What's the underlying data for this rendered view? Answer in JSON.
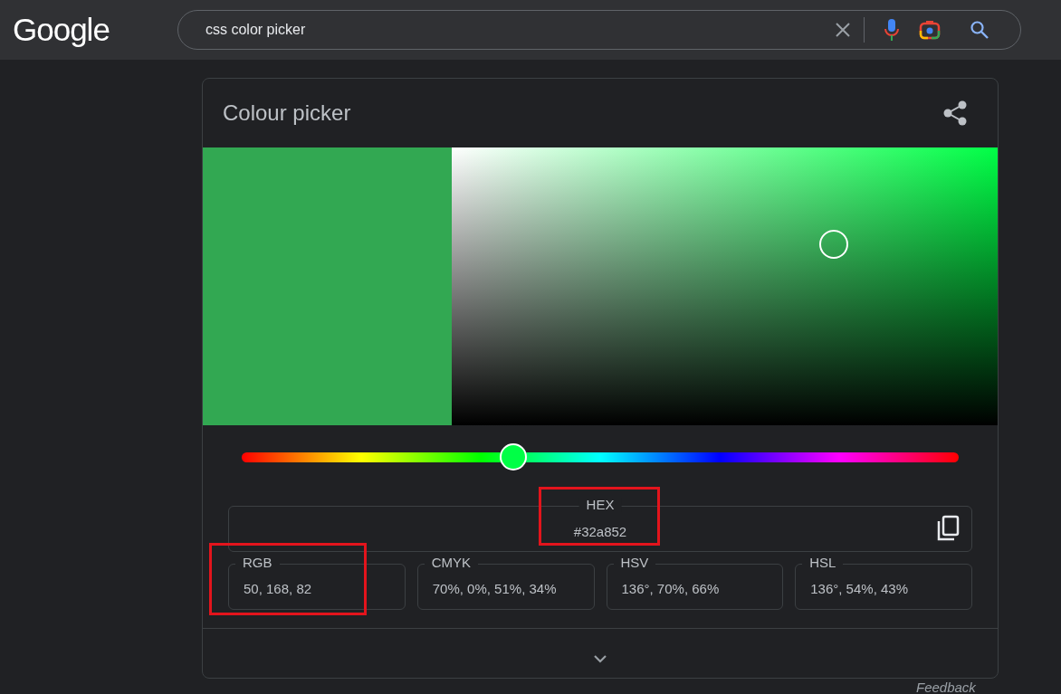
{
  "header": {
    "logo": "Google",
    "search": {
      "value": "css color picker"
    }
  },
  "card": {
    "title": "Colour picker",
    "picker": {
      "saturation": {
        "level": 0.7
      },
      "brightness": {
        "level": 0.65
      }
    },
    "hue": {
      "level": 0.379
    },
    "hex": {
      "label": "HEX",
      "value": "#32a852",
      "highlighted": true
    },
    "formats": [
      {
        "label": "RGB",
        "value": "50, 168, 82",
        "highlighted": true
      },
      {
        "label": "CMYK",
        "value": "70%, 0%, 51%, 34%",
        "highlighted": false
      },
      {
        "label": "HSV",
        "value": "136°, 70%, 66%",
        "highlighted": false
      },
      {
        "label": "HSL",
        "value": "136°, 54%, 43%",
        "highlighted": false
      }
    ]
  },
  "feedback": "Feedback"
}
